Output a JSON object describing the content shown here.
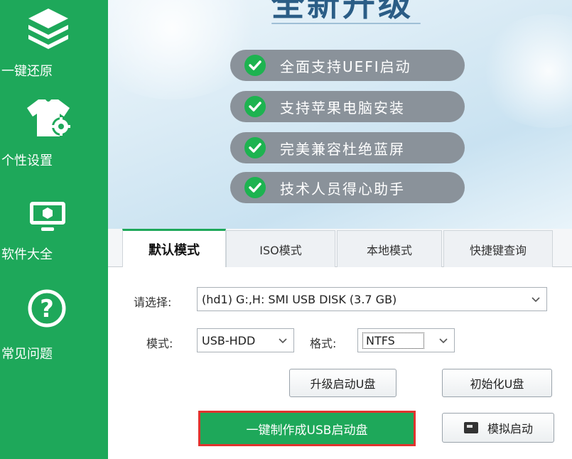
{
  "sidebar": {
    "items": [
      {
        "label": "一键还原",
        "icon": "layers-icon"
      },
      {
        "label": "个性设置",
        "icon": "tshirt-gear-icon"
      },
      {
        "label": "软件大全",
        "icon": "monitor-icon"
      },
      {
        "label": "常见问题",
        "icon": "question-icon"
      }
    ]
  },
  "banner": {
    "title": "全新升级",
    "features": [
      "全面支持UEFI启动",
      "支持苹果电脑安装",
      "完美兼容杜绝蓝屏",
      "技术人员得心助手"
    ]
  },
  "tabs": [
    {
      "label": "默认模式",
      "active": true
    },
    {
      "label": "ISO模式",
      "active": false
    },
    {
      "label": "本地模式",
      "active": false
    },
    {
      "label": "快捷键查询",
      "active": false
    }
  ],
  "form": {
    "select_label": "请选择:",
    "device_value": "(hd1) G:,H: SMI USB DISK (3.7 GB)",
    "mode_label": "模式:",
    "mode_value": "USB-HDD",
    "format_label": "格式:",
    "format_value": "NTFS"
  },
  "buttons": {
    "upgrade": "升级启动U盘",
    "init": "初始化U盘",
    "make": "一键制作成USB启动盘",
    "simulate": "模拟启动"
  },
  "colors": {
    "sidebar_green": "#1ea85a",
    "highlight_red": "#e0332e",
    "feature_pill": "#8a929a"
  }
}
